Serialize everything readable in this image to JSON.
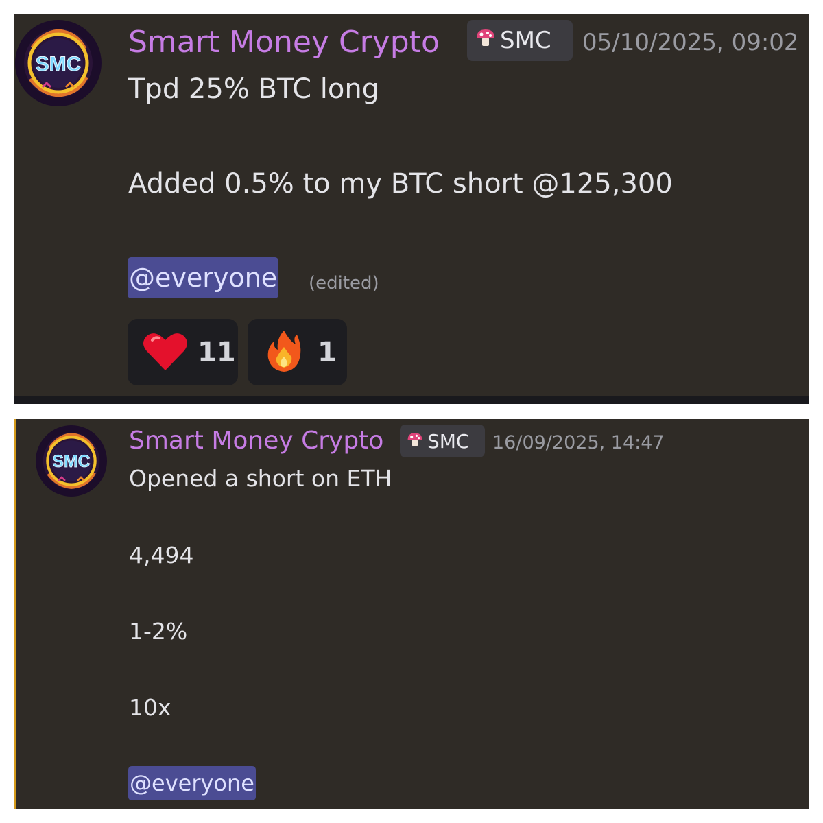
{
  "message1": {
    "author": "Smart Money Crypto",
    "role_tag": "SMC",
    "timestamp": "05/10/2025, 09:02",
    "lines": [
      "Tpd 25% BTC long",
      "Added 0.5% to my BTC short @125,300"
    ],
    "mention": "@everyone",
    "edited_label": "(edited)",
    "reactions": [
      {
        "emoji": "heart-icon",
        "count": "11"
      },
      {
        "emoji": "fire-icon",
        "count": "1"
      }
    ]
  },
  "message2": {
    "author": "Smart Money Crypto",
    "role_tag": "SMC",
    "timestamp": "16/09/2025, 14:47",
    "lines": [
      "Opened a short on ETH",
      "4,494",
      "1-2%",
      "10x"
    ],
    "mention": "@everyone"
  },
  "colors": {
    "background": "#2f2b26",
    "author": "#c67ce4",
    "mention_bg": "#4b4c93",
    "highlight_bar": "#d49a1a"
  }
}
